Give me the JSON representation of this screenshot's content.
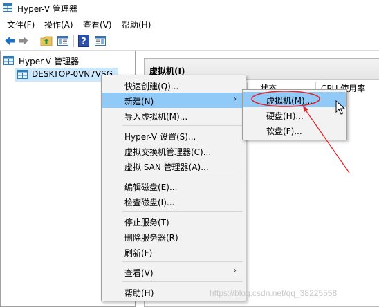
{
  "window": {
    "title": "Hyper-V 管理器"
  },
  "menubar": {
    "items": [
      "文件(F)",
      "操作(A)",
      "查看(V)",
      "帮助(H)"
    ]
  },
  "tree": {
    "root_label": "Hyper-V 管理器",
    "child_label": "DESKTOP-0VN7VSG"
  },
  "pane": {
    "title": "虚拟机(I)",
    "columns": [
      "状态",
      "CPU 使用率"
    ]
  },
  "context_menu": {
    "items": [
      {
        "label": "快速创建(Q)..."
      },
      {
        "label": "新建(N)"
      },
      {
        "label": "导入虚拟机(M)..."
      },
      {
        "label": "Hyper-V 设置(S)..."
      },
      {
        "label": "虚拟交换机管理器(C)..."
      },
      {
        "label": "虚拟 SAN 管理器(A)..."
      },
      {
        "label": "编辑磁盘(E)..."
      },
      {
        "label": "检查磁盘(I)..."
      },
      {
        "label": "停止服务(T)"
      },
      {
        "label": "删除服务器(R)"
      },
      {
        "label": "刷新(F)"
      },
      {
        "label": "查看(V)"
      },
      {
        "label": "帮助(H)"
      }
    ],
    "submenu_arrow": "›"
  },
  "submenu": {
    "items": [
      {
        "label": "虚拟机(M)..."
      },
      {
        "label": "硬盘(H)..."
      },
      {
        "label": "软盘(F)..."
      }
    ]
  },
  "watermark": "https://blog.csdn.net/qq_38225558",
  "colors": {
    "highlight": "#91c9f7",
    "tree_selection": "#cce8ff",
    "annotation": "#e0262a"
  },
  "icons": [
    "hyperv-app-icon",
    "back-arrow-icon",
    "forward-arrow-icon",
    "folder-up-icon",
    "show-hide-tree-icon",
    "help-icon",
    "action-pane-icon",
    "server-icon",
    "mouse-cursor-icon"
  ]
}
